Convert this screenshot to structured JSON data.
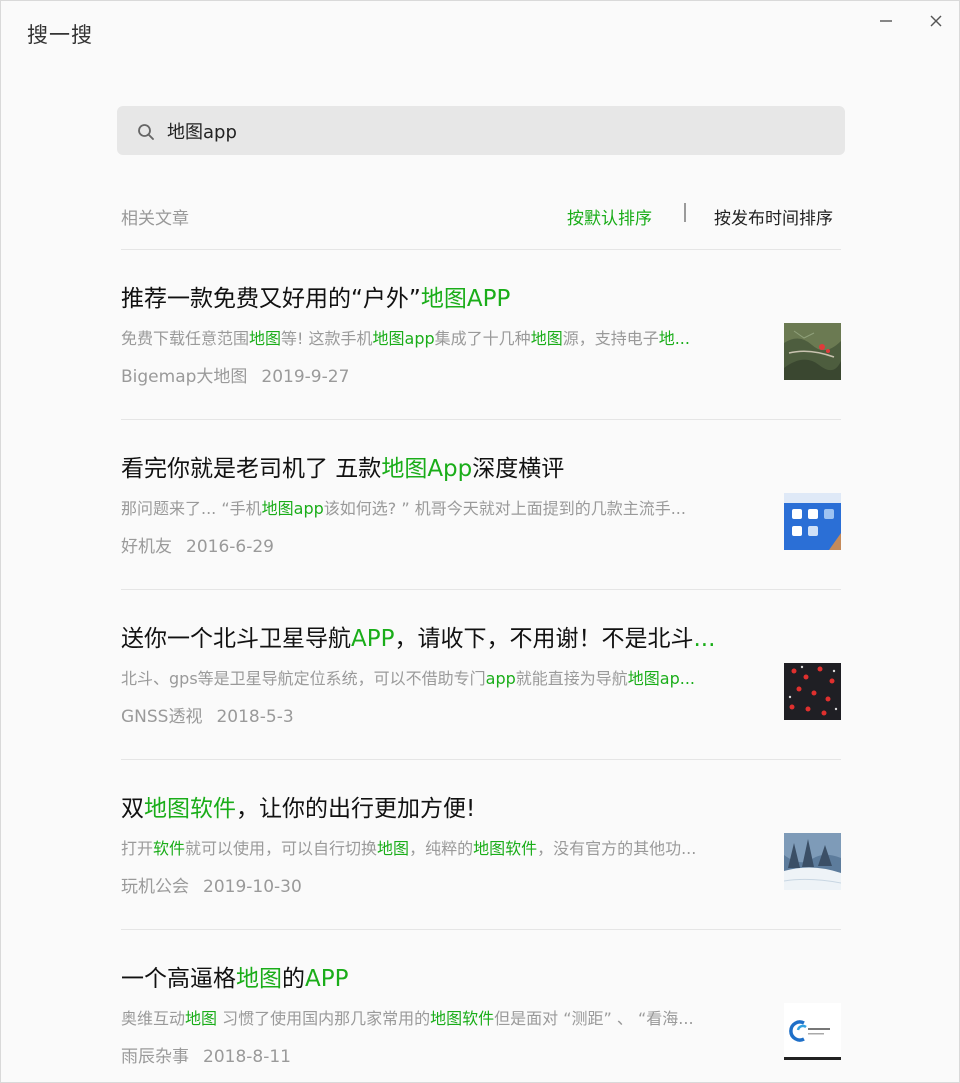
{
  "window": {
    "title": "搜一搜",
    "minimize_icon": "minimize-icon",
    "close_icon": "close-icon"
  },
  "search": {
    "icon": "search-icon",
    "value": "地图app",
    "placeholder": ""
  },
  "section": {
    "label": "相关文章",
    "sort_default": "按默认排序",
    "sort_time": "按发布时间排序",
    "active_sort_color": "#1aad19"
  },
  "highlight_color": "#1aad19",
  "articles": [
    {
      "title": [
        {
          "t": "推荐一款免费又好用的“户外”"
        },
        {
          "t": "地图APP",
          "hl": true
        }
      ],
      "snippet": [
        {
          "t": "免费下载任意范围"
        },
        {
          "t": "地图",
          "hl": true
        },
        {
          "t": "等! 这款手机"
        },
        {
          "t": "地图app",
          "hl": true
        },
        {
          "t": "集成了十几种"
        },
        {
          "t": "地图",
          "hl": true
        },
        {
          "t": "源，支持电子"
        },
        {
          "t": "地...",
          "hl": true
        }
      ],
      "source": "Bigemap大地图",
      "date": "2019-9-27",
      "thumbnail": "satellite-map-thumbnail"
    },
    {
      "title": [
        {
          "t": "看完你就是老司机了 五款"
        },
        {
          "t": "地图App",
          "hl": true
        },
        {
          "t": "深度横评"
        }
      ],
      "snippet": [
        {
          "t": "那问题来了... “手机"
        },
        {
          "t": "地图app",
          "hl": true
        },
        {
          "t": "该如何选? ” 机哥今天就对上面提到的几款主流手..."
        }
      ],
      "source": "好机友",
      "date": "2016-6-29",
      "thumbnail": "phone-apps-thumbnail"
    },
    {
      "title": [
        {
          "t": "送你一个北斗卫星导航"
        },
        {
          "t": "APP",
          "hl": true
        },
        {
          "t": "，请收下，不用谢！不是北斗"
        },
        {
          "t": "...",
          "hl": true
        }
      ],
      "snippet": [
        {
          "t": "北斗、gps等是卫星导航定位系统，可以不借助专门"
        },
        {
          "t": "app",
          "hl": true
        },
        {
          "t": "就能直接为导航"
        },
        {
          "t": "地图ap...",
          "hl": true
        }
      ],
      "source": "GNSS透视",
      "date": "2018-5-3",
      "thumbnail": "satellite-dots-thumbnail"
    },
    {
      "title": [
        {
          "t": "双"
        },
        {
          "t": "地图软件",
          "hl": true
        },
        {
          "t": "，让你的出行更加方便!"
        }
      ],
      "snippet": [
        {
          "t": "打开"
        },
        {
          "t": "软件",
          "hl": true
        },
        {
          "t": "就可以使用，可以自行切换"
        },
        {
          "t": "地图",
          "hl": true
        },
        {
          "t": "，纯粹的"
        },
        {
          "t": "地图软件",
          "hl": true
        },
        {
          "t": "，没有官方的其他功..."
        }
      ],
      "source": "玩机公会",
      "date": "2019-10-30",
      "thumbnail": "snowy-forest-thumbnail"
    },
    {
      "title": [
        {
          "t": "一个高逼格"
        },
        {
          "t": "地图",
          "hl": true
        },
        {
          "t": "的"
        },
        {
          "t": "APP",
          "hl": true
        }
      ],
      "snippet": [
        {
          "t": "奥维互动"
        },
        {
          "t": "地图",
          "hl": true
        },
        {
          "t": " 习惯了使用国内那几家常用的"
        },
        {
          "t": "地图软件",
          "hl": true
        },
        {
          "t": "但是面对 “测距” 、 “看海..."
        }
      ],
      "source": "雨辰杂事",
      "date": "2018-8-11",
      "thumbnail": "logo-thumbnail"
    }
  ]
}
